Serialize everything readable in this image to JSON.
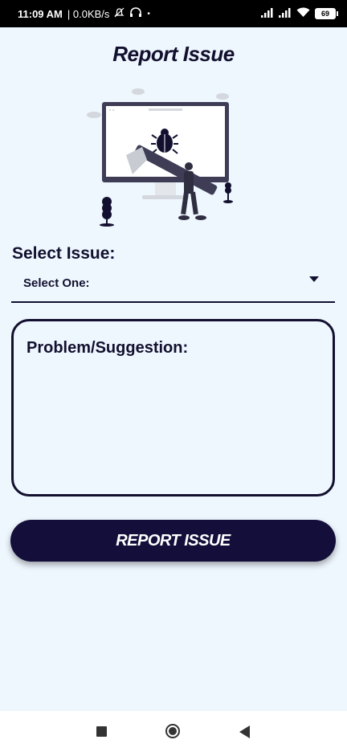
{
  "status_bar": {
    "time": "11:09 AM",
    "speed": "| 0.0KB/s",
    "battery": "69"
  },
  "header": {
    "title": "Report Issue"
  },
  "form": {
    "select_label": "Select Issue:",
    "select_value": "Select One:",
    "textarea_placeholder": "Problem/Suggestion:",
    "submit_label": "REPORT ISSUE"
  },
  "colors": {
    "background": "#eef6fe",
    "primary": "#130e3a",
    "text": "#12102e"
  },
  "icons": [
    "mute-icon",
    "headphones-icon",
    "signal-icon",
    "wifi-icon",
    "battery-icon",
    "bug-illustration",
    "dropdown-arrow-icon",
    "recents-icon",
    "home-icon",
    "back-icon"
  ]
}
